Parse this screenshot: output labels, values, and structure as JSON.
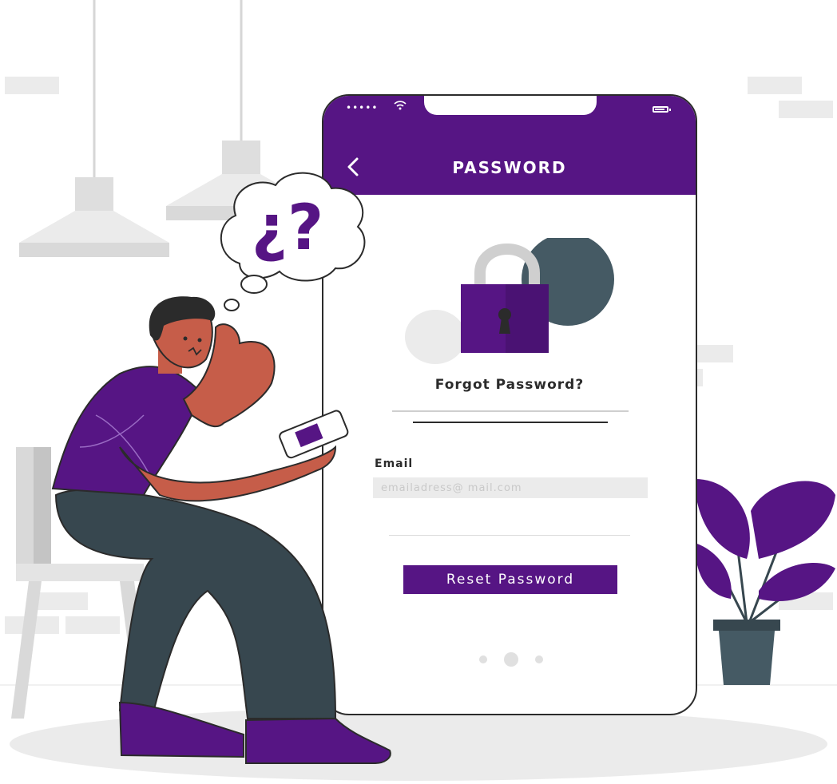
{
  "status_bar": {
    "dots": "•••••"
  },
  "header": {
    "title": "PASSWORD"
  },
  "main": {
    "heading": "Forgot Password?",
    "email_label": "Email",
    "email_placeholder": "emailadress@ mail.com",
    "email_value": "",
    "reset_label": "Reset Password"
  },
  "bubble": {
    "text": "¿?"
  },
  "pager": {
    "count": 3,
    "active": 1
  },
  "colors": {
    "brand": "#561584",
    "dark": "#37474f",
    "skin": "#c65d49",
    "light_gray": "#ebebeb"
  }
}
